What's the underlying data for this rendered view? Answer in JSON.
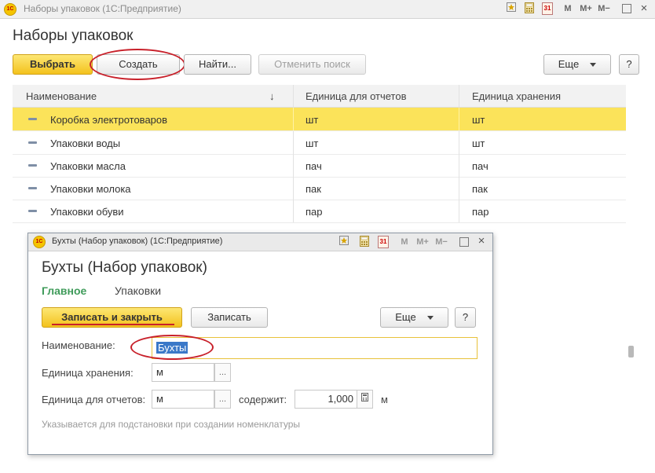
{
  "window": {
    "title": "Наборы упаковок  (1С:Предприятие)",
    "logo_text": "1С",
    "toolbar": {
      "m": "M",
      "m_plus": "M+",
      "m_minus": "M−",
      "calendar_num": "31",
      "close": "×"
    }
  },
  "page": {
    "title": "Наборы упаковок",
    "buttons": {
      "select": "Выбрать",
      "create": "Создать",
      "find": "Найти...",
      "cancel_search": "Отменить поиск",
      "more": "Еще",
      "help": "?"
    }
  },
  "table": {
    "columns": [
      "Наименование",
      "Единица для отчетов",
      "Единица хранения"
    ],
    "sort_indicator": "↓",
    "rows": [
      {
        "name": "Коробка электротоваров",
        "report_unit": "шт",
        "storage_unit": "шт",
        "selected": true
      },
      {
        "name": "Упаковки воды",
        "report_unit": "шт",
        "storage_unit": "шт"
      },
      {
        "name": "Упаковки масла",
        "report_unit": "пач",
        "storage_unit": "пач"
      },
      {
        "name": "Упаковки молока",
        "report_unit": "пак",
        "storage_unit": "пак"
      },
      {
        "name": "Упаковки обуви",
        "report_unit": "пар",
        "storage_unit": "пар"
      }
    ]
  },
  "dialog": {
    "window_title": "Бухты (Набор упаковок)  (1С:Предприятие)",
    "logo_text": "1С",
    "toolbar": {
      "m": "M",
      "m_plus": "M+",
      "m_minus": "M−",
      "calendar_num": "31",
      "close": "×"
    },
    "heading": "Бухты (Набор упаковок)",
    "tabs": {
      "main": "Главное",
      "packages": "Упаковки"
    },
    "buttons": {
      "save_close": "Записать и закрыть",
      "save": "Записать",
      "more": "Еще",
      "help": "?"
    },
    "fields": {
      "name_label": "Наименование:",
      "name_value": "Бухты",
      "storage_label": "Единица хранения:",
      "storage_value": "м",
      "report_label": "Единица для отчетов:",
      "report_value": "м",
      "contains_label": "содержит:",
      "contains_value": "1,000",
      "contains_unit": "м",
      "dots": "..."
    },
    "hint": "Указывается для подстановки при создании номенклатуры"
  },
  "colors": {
    "accent_yellow": "#f3c21d",
    "selected_row": "#fbe35a",
    "tab_active": "#3f9b5a",
    "annotation_red": "#c8202a"
  }
}
